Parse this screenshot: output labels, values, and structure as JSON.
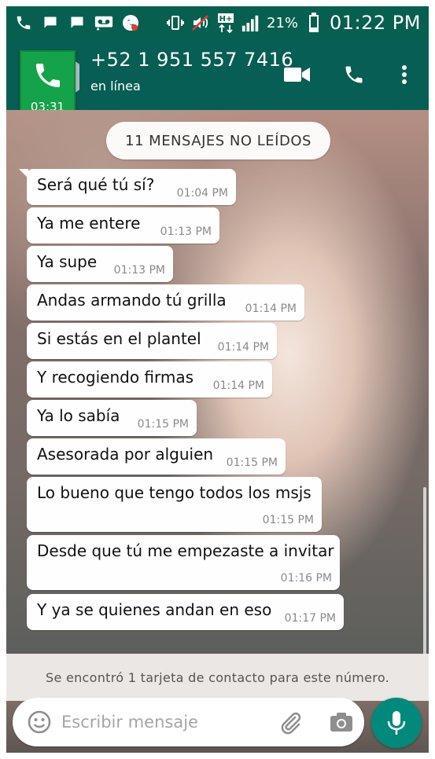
{
  "status_bar": {
    "battery_percent": "21%",
    "time": "01:22 PM",
    "icons": [
      "phone-icon",
      "message-icon",
      "message-icon",
      "voicemail-icon",
      "whatsapp-icon",
      "vibrate-icon",
      "mute-icon",
      "hplus-icon",
      "signal-icon",
      "battery-icon"
    ]
  },
  "header": {
    "contact": "+52 1 951 557 7416",
    "status": "en línea",
    "icons": [
      "back-arrow-icon",
      "video-call-icon",
      "phone-call-icon",
      "more-vert-icon"
    ]
  },
  "call_overlay": {
    "duration": "03:31"
  },
  "chat": {
    "unread_label": "11 MENSAJES NO LEÍDOS",
    "messages": [
      {
        "text": "Será qué tú sí?",
        "time": "01:04 PM"
      },
      {
        "text": "Ya me entere",
        "time": "01:13 PM"
      },
      {
        "text": "Ya supe",
        "time": "01:13 PM"
      },
      {
        "text": "Andas armando tú grilla",
        "time": "01:14 PM"
      },
      {
        "text": "Si estás en el plantel",
        "time": "01:14 PM"
      },
      {
        "text": "Y recogiendo firmas",
        "time": "01:14 PM"
      },
      {
        "text": "Ya lo sabía",
        "time": "01:15 PM"
      },
      {
        "text": "Asesorada por alguien",
        "time": "01:15 PM"
      },
      {
        "text": "Lo bueno que tengo todos los msjs",
        "time": "01:15 PM"
      },
      {
        "text": "Desde que tú me empezaste a invitar",
        "time": "01:16 PM"
      },
      {
        "text": "Y ya se quienes andan en eso",
        "time": "01:17 PM"
      }
    ]
  },
  "notice": "Se encontró 1 tarjeta de contacto para este número.",
  "composer": {
    "placeholder": "Escribir mensaje"
  },
  "colors": {
    "header": "#075e54",
    "accent": "#01897b",
    "call_badge": "#14a34a",
    "bubble": "#ffffff"
  }
}
